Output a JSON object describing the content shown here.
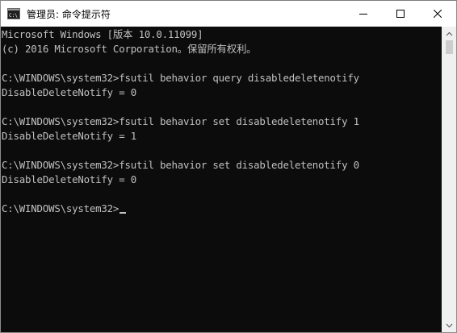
{
  "window": {
    "title": "管理员: 命令提示符"
  },
  "caption": {
    "minimize_icon": "minimize-icon",
    "maximize_icon": "maximize-icon",
    "close_icon": "close-icon"
  },
  "console": {
    "lines": [
      "Microsoft Windows [版本 10.0.11099]",
      "(c) 2016 Microsoft Corporation。保留所有权利。",
      "",
      "C:\\WINDOWS\\system32>fsutil behavior query disabledeletenotify",
      "DisableDeleteNotify = 0",
      "",
      "C:\\WINDOWS\\system32>fsutil behavior set disabledeletenotify 1",
      "DisableDeleteNotify = 1",
      "",
      "C:\\WINDOWS\\system32>fsutil behavior set disabledeletenotify 0",
      "DisableDeleteNotify = 0",
      "",
      "C:\\WINDOWS\\system32>"
    ]
  },
  "colors": {
    "console_background": "#0c0c0c",
    "console_text": "#c0c0c0",
    "titlebar_background": "#ffffff"
  }
}
